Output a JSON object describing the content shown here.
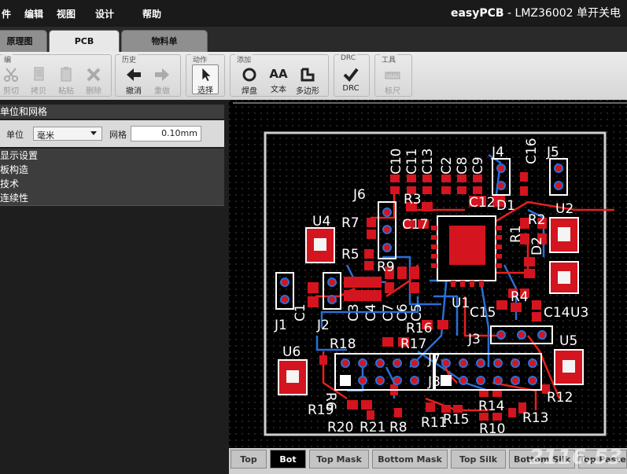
{
  "menubar": {
    "items": [
      "件",
      "编辑",
      "视图",
      "设计",
      "帮助"
    ],
    "title_app": "easyPCB",
    "title_doc": " - LMZ36002 单开关电"
  },
  "doc_tabs": [
    {
      "label": "原理图"
    },
    {
      "label": "PCB"
    },
    {
      "label": "物料单"
    }
  ],
  "toolbar": {
    "groups": [
      {
        "title": "编",
        "buttons": [
          "剪切",
          "拷贝",
          "粘贴",
          "删除"
        ]
      },
      {
        "title": "历史",
        "buttons": [
          "撤消",
          "重做"
        ]
      },
      {
        "title": "动作",
        "buttons": [
          "选择"
        ]
      },
      {
        "title": "添加",
        "buttons": [
          "焊盘",
          "文本",
          "多边形"
        ]
      },
      {
        "title": "DRC",
        "buttons": [
          "DRC"
        ]
      },
      {
        "title": "工具",
        "buttons": [
          "标尺"
        ]
      }
    ],
    "text_icon": "AA"
  },
  "panel": {
    "units_grid_header": "单位和网格",
    "unit_label": "单位",
    "unit_value": "毫米",
    "grid_label": "网格",
    "grid_value": "0.10mm",
    "sections": [
      "显示设置",
      "板构造",
      "技术",
      "连续性"
    ]
  },
  "pcb": {
    "labels": [
      "C10",
      "C11",
      "C13",
      "C2",
      "C8",
      "C9",
      "J4",
      "C16",
      "J5",
      "J6",
      "R3",
      "C12",
      "D1",
      "R2",
      "U2",
      "U4",
      "R7",
      "C17",
      "R1",
      "D2",
      "R5",
      "R9",
      "R4",
      "C15",
      "C14",
      "U3",
      "J1",
      "C1",
      "J2",
      "C3",
      "C4",
      "C7",
      "C6",
      "C5",
      "U1",
      "R16",
      "J3",
      "U6",
      "R18",
      "R17",
      "U5",
      "J7",
      "R6",
      "J8",
      "R12",
      "R19",
      "R14",
      "R13",
      "R11",
      "R15",
      "R20",
      "R21",
      "R8",
      "R10"
    ],
    "colors": {
      "pads": "#d4141e",
      "traces_top": "#e8201e",
      "traces_bottom": "#2a6fd6",
      "silk": "#ffffff",
      "board": "#000000"
    }
  },
  "layer_tabs": [
    "Top",
    "Bot",
    "Top Mask",
    "Bottom Mask",
    "Top Silk",
    "Bottom Silk",
    "Top Paste"
  ],
  "watermark": "2116.53"
}
